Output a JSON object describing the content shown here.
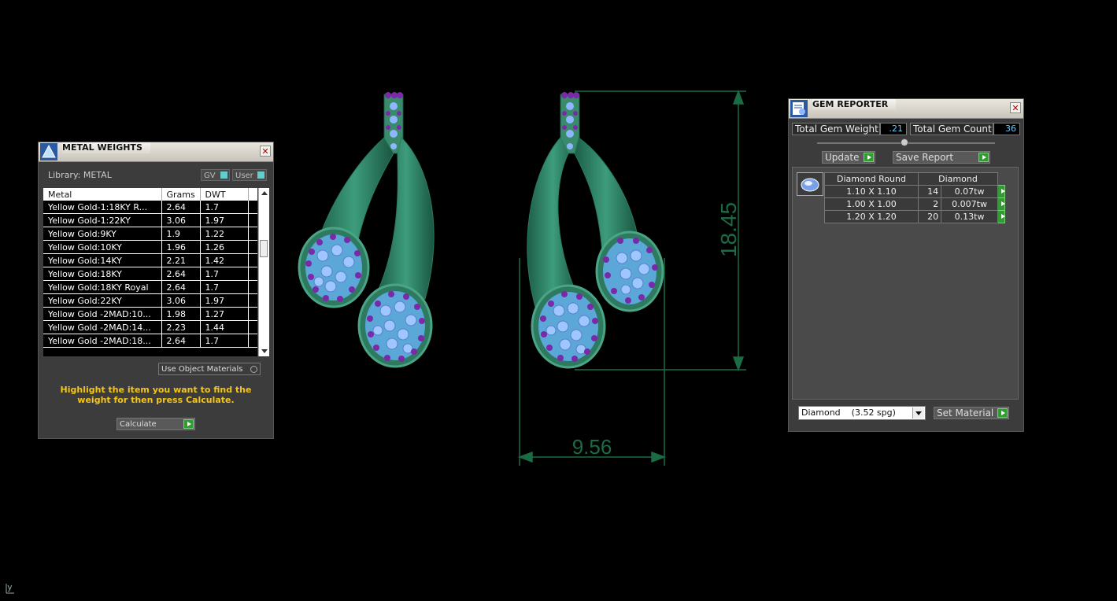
{
  "metal_panel": {
    "title": "METAL WEIGHTS",
    "library_label": "Library: METAL",
    "gv_label": "GV",
    "user_label": "User",
    "columns": [
      "Metal",
      "Grams",
      "DWT"
    ],
    "rows": [
      [
        "Yellow Gold-1:18KY R...",
        "2.64",
        "1.7"
      ],
      [
        "Yellow Gold-1:22KY",
        "3.06",
        "1.97"
      ],
      [
        "Yellow Gold:9KY",
        "1.9",
        "1.22"
      ],
      [
        "Yellow Gold:10KY",
        "1.96",
        "1.26"
      ],
      [
        "Yellow Gold:14KY",
        "2.21",
        "1.42"
      ],
      [
        "Yellow Gold:18KY",
        "2.64",
        "1.7"
      ],
      [
        "Yellow Gold:18KY Royal",
        "2.64",
        "1.7"
      ],
      [
        "Yellow Gold:22KY",
        "3.06",
        "1.97"
      ],
      [
        "Yellow Gold -2MAD:10...",
        "1.98",
        "1.27"
      ],
      [
        "Yellow Gold -2MAD:14...",
        "2.23",
        "1.44"
      ],
      [
        "Yellow Gold -2MAD:18...",
        "2.64",
        "1.7"
      ]
    ],
    "use_object_materials": "Use Object Materials",
    "hint": "Highlight the item you want to find the weight for then press Calculate.",
    "calculate_label": "Calculate"
  },
  "gem_panel": {
    "title": "GEM REPORTER",
    "total_weight_label": "Total Gem Weight",
    "total_weight_value": ".21",
    "total_count_label": "Total Gem Count",
    "total_count_value": "36",
    "update_label": "Update",
    "save_report_label": "Save Report",
    "table_headers": [
      "Diamond Round",
      "Diamond"
    ],
    "rows": [
      [
        "1.10 X 1.10",
        "14",
        "0.07tw"
      ],
      [
        "1.00 X 1.00",
        "2",
        "0.007tw"
      ],
      [
        "1.20 X 1.20",
        "20",
        "0.13tw"
      ]
    ],
    "material_select": "Diamond    (3.52 spg)",
    "set_material_label": "Set Material"
  },
  "viewport": {
    "dim_height": "18.45",
    "dim_width": "9.56",
    "axis_label": "y"
  },
  "colors": {
    "accent": "#2f9d2f",
    "dimension": "#1b6b45",
    "metal": "#2e8a6a"
  }
}
